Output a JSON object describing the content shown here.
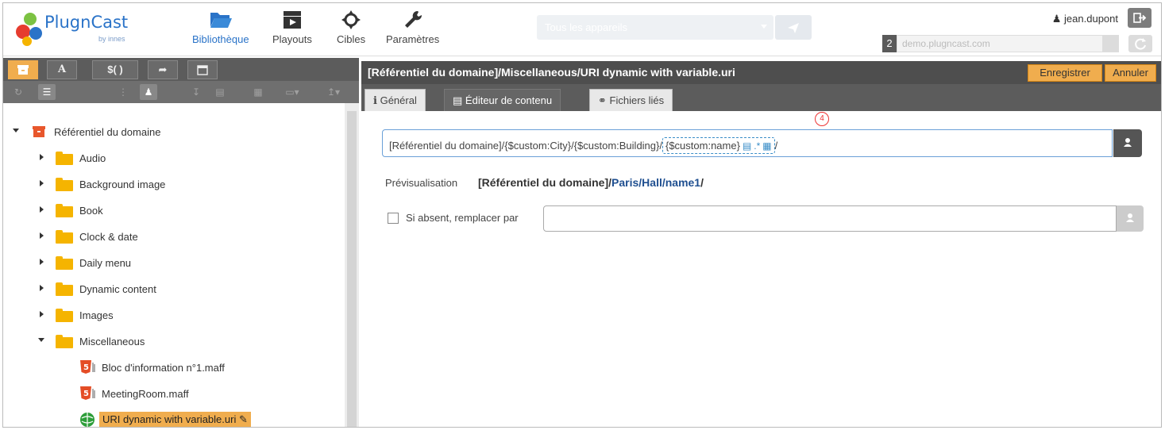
{
  "app": {
    "logo_text": "PlugnCast",
    "logo_sub": "by innes"
  },
  "nav": [
    {
      "label": "Bibliothèque",
      "icon": "folder-open-icon",
      "active": true
    },
    {
      "label": "Playouts",
      "icon": "clapperboard-icon",
      "active": false
    },
    {
      "label": "Cibles",
      "icon": "crosshair-icon",
      "active": false
    },
    {
      "label": "Paramètres",
      "icon": "wrench-icon",
      "active": false
    }
  ],
  "device_selector": {
    "value": "Tous les appareils"
  },
  "user": {
    "name": "jean.dupont"
  },
  "domain": {
    "number": "2",
    "value": "demo.plugncast.com"
  },
  "left_tabs": [
    {
      "label": "",
      "icon": "archive-icon",
      "active": true
    },
    {
      "label": "A",
      "icon": "text-icon",
      "active": false
    },
    {
      "label": "$( )",
      "icon": "variable-icon",
      "active": false
    },
    {
      "label": "",
      "icon": "link-icon",
      "active": false
    },
    {
      "label": "",
      "icon": "calendar-icon",
      "active": false
    }
  ],
  "tree": {
    "root": "Référentiel du domaine",
    "folders": [
      "Audio",
      "Background image",
      "Book",
      "Clock & date",
      "Daily menu",
      "Dynamic content",
      "Images",
      "Miscellaneous"
    ],
    "files": [
      {
        "label": "Bloc d'information n°1.maff",
        "type": "html5"
      },
      {
        "label": "MeetingRoom.maff",
        "type": "html5"
      },
      {
        "label": "URI dynamic with variable.uri",
        "type": "uri",
        "selected": true
      }
    ]
  },
  "editor": {
    "path_title": "[Référentiel du domaine]/Miscellaneous/URI dynamic with variable.uri",
    "save_label": "Enregistrer",
    "cancel_label": "Annuler",
    "tabs": [
      {
        "label": "Général",
        "icon": "info-icon",
        "active": false
      },
      {
        "label": "Éditeur de contenu",
        "icon": "document-icon",
        "active": true
      },
      {
        "label": "Fichiers liés",
        "icon": "link-icon",
        "active": false
      }
    ],
    "uri_prefix": "[Référentiel du domaine]/{$custom:City}/{$custom:Building}/",
    "uri_variable": "{$custom:name}",
    "uri_suffix": "/",
    "callout_number": "4",
    "preview_label": "Prévisualisation",
    "preview_root": "[Référentiel du domaine]/",
    "preview_vars": "Paris/Hall/name1",
    "preview_end": "/",
    "replace_label": "Si absent, remplacer par",
    "replace_value": ""
  }
}
